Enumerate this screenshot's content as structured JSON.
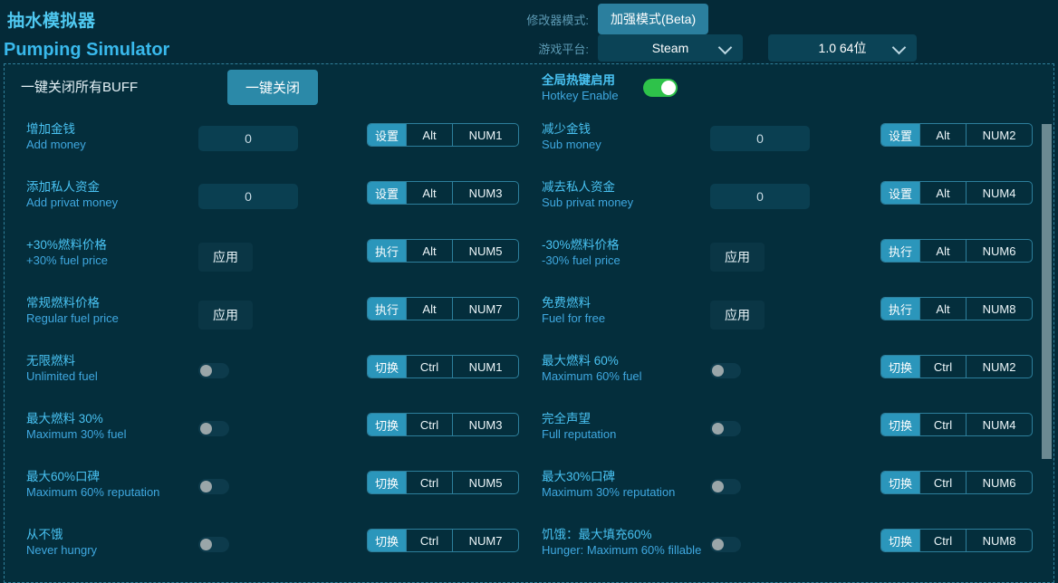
{
  "header": {
    "title_zh": "抽水模拟器",
    "title_en": "Pumping Simulator",
    "mode_label": "修改器模式:",
    "mode_value": "加强模式(Beta)",
    "platform_label": "游戏平台:",
    "platform_value": "Steam",
    "version_value": "1.0 64位"
  },
  "top": {
    "close_all_label": "一键关闭所有BUFF",
    "close_all_button": "一键关闭",
    "hotkey_enable_zh": "全局热键启用",
    "hotkey_enable_en": "Hotkey Enable",
    "hotkey_enable_state": "on"
  },
  "rows": [
    {
      "zh": "增加金钱",
      "en": "Add money",
      "control": "input",
      "value": "0",
      "hk_action": "设置",
      "hk_mod": "Alt",
      "hk_key": "NUM1"
    },
    {
      "zh": "减少金钱",
      "en": "Sub money",
      "control": "input",
      "value": "0",
      "hk_action": "设置",
      "hk_mod": "Alt",
      "hk_key": "NUM2"
    },
    {
      "zh": "添加私人资金",
      "en": "Add privat money",
      "control": "input",
      "value": "0",
      "hk_action": "设置",
      "hk_mod": "Alt",
      "hk_key": "NUM3"
    },
    {
      "zh": "减去私人资金",
      "en": "Sub privat money",
      "control": "input",
      "value": "0",
      "hk_action": "设置",
      "hk_mod": "Alt",
      "hk_key": "NUM4"
    },
    {
      "zh": "+30%燃料价格",
      "en": "+30% fuel price",
      "control": "button",
      "value": "应用",
      "hk_action": "执行",
      "hk_mod": "Alt",
      "hk_key": "NUM5"
    },
    {
      "zh": "-30%燃料价格",
      "en": "-30% fuel price",
      "control": "button",
      "value": "应用",
      "hk_action": "执行",
      "hk_mod": "Alt",
      "hk_key": "NUM6"
    },
    {
      "zh": "常规燃料价格",
      "en": "Regular fuel price",
      "control": "button",
      "value": "应用",
      "hk_action": "执行",
      "hk_mod": "Alt",
      "hk_key": "NUM7"
    },
    {
      "zh": "免费燃料",
      "en": "Fuel for free",
      "control": "button",
      "value": "应用",
      "hk_action": "执行",
      "hk_mod": "Alt",
      "hk_key": "NUM8"
    },
    {
      "zh": "无限燃料",
      "en": "Unlimited fuel",
      "control": "toggle",
      "value": "off",
      "hk_action": "切换",
      "hk_mod": "Ctrl",
      "hk_key": "NUM1"
    },
    {
      "zh": "最大燃料 60%",
      "en": "Maximum 60% fuel",
      "control": "toggle",
      "value": "off",
      "hk_action": "切换",
      "hk_mod": "Ctrl",
      "hk_key": "NUM2"
    },
    {
      "zh": "最大燃料 30%",
      "en": "Maximum 30% fuel",
      "control": "toggle",
      "value": "off",
      "hk_action": "切换",
      "hk_mod": "Ctrl",
      "hk_key": "NUM3"
    },
    {
      "zh": "完全声望",
      "en": "Full reputation",
      "control": "toggle",
      "value": "off",
      "hk_action": "切换",
      "hk_mod": "Ctrl",
      "hk_key": "NUM4"
    },
    {
      "zh": "最大60%口碑",
      "en": "Maximum 60% reputation",
      "control": "toggle",
      "value": "off",
      "hk_action": "切换",
      "hk_mod": "Ctrl",
      "hk_key": "NUM5"
    },
    {
      "zh": "最大30%口碑",
      "en": "Maximum 30% reputation",
      "control": "toggle",
      "value": "off",
      "hk_action": "切换",
      "hk_mod": "Ctrl",
      "hk_key": "NUM6"
    },
    {
      "zh": "从不饿",
      "en": "Never hungry",
      "control": "toggle",
      "value": "off",
      "hk_action": "切换",
      "hk_mod": "Ctrl",
      "hk_key": "NUM7"
    },
    {
      "zh": "饥饿：最大填充60%",
      "en": "Hunger: Maximum 60% fillable",
      "control": "toggle",
      "value": "off",
      "hk_action": "切换",
      "hk_mod": "Ctrl",
      "hk_key": "NUM8"
    }
  ],
  "colors": {
    "background": "#042a38",
    "panel": "#042e3c",
    "accent": "#49c2f2",
    "accent_button": "#2b96bb",
    "toggle_on": "#2ec24a",
    "border_dashed": "#2f7f9a"
  }
}
